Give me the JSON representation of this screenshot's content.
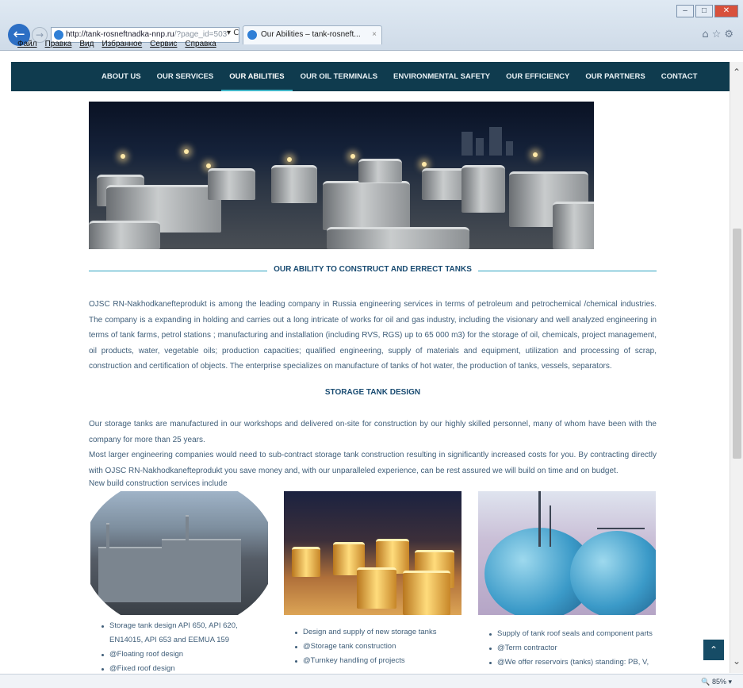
{
  "browser": {
    "address_host": "http://tank-rosneftnadka-nnp.ru",
    "address_path": "/?page_id=503",
    "address_controls": "▾ C",
    "tab_title": "Our Abilities – tank-rosneft...",
    "tab_close": "×",
    "menu": [
      "Файл",
      "Правка",
      "Вид",
      "Избранное",
      "Сервис",
      "Справка"
    ],
    "zoom": "85%"
  },
  "nav": {
    "items": [
      "ABOUT US",
      "OUR SERVICES",
      "OUR ABILITIES",
      "OUR OIL TERMINALS",
      "ENVIRONMENTAL SAFETY",
      "OUR EFFICIENCY",
      "OUR PARTNERS",
      "CONTACT"
    ],
    "active": "OUR ABILITIES",
    "accent_color": "#0f3b4e"
  },
  "section": {
    "title": "OUR ABILITY TO CONSTRUCT AND ERRECT TANKS",
    "intro": "OJSC RN-Nakhodkanefteprodukt is among the leading company in Russia engineering services in terms of petroleum and petrochemical /chemical industries. The company is a expanding in holding and carries out a long intricate of works for oil and gas industry, including the visionary and well analyzed engineering in terms of tank farms, petrol stations ; manufacturing and installation (including RVS, RGS) up to 65 000 m3) for the storage of oil, chemicals, project management, oil products, water, vegetable oils; production capacities; qualified engineering, supply of materials and equipment, utilization and processing of scrap, construction and certification of objects. The enterprise specializes on manufacture of tanks of hot water, the production of tanks, vessels, separators."
  },
  "design": {
    "title": "STORAGE TANK DESIGN",
    "p1": "Our storage tanks are manufactured in our workshops and delivered on-site for construction by our highly skilled personnel, many of whom have been with the company for more than 25 years.",
    "p2": "Most larger engineering companies would need to sub-contract storage tank construction resulting in significantly increased costs for you. By contracting directly with OJSC RN-Nakhodkanefteprodukt you save money and, with our unparalleled experience, can be rest assured we will build on time and on budget.",
    "p3": "New build construction services include"
  },
  "lists": {
    "col1": [
      "Storage tank design API 650, API 620, EN14015, API 653 and EEMUA 159",
      "@Floating roof design",
      "@Fixed roof design"
    ],
    "col2": [
      "Design and supply of new storage tanks",
      "@Storage tank construction",
      "@Turnkey handling of projects"
    ],
    "col3": [
      "Supply of tank roof seals and component parts",
      "@Term contractor",
      "@We offer reservoirs (tanks) standing: PB, V,"
    ]
  },
  "icons": {
    "back": "back-arrow-icon",
    "forward": "forward-arrow-icon",
    "to_top": "chevron-up-icon"
  }
}
